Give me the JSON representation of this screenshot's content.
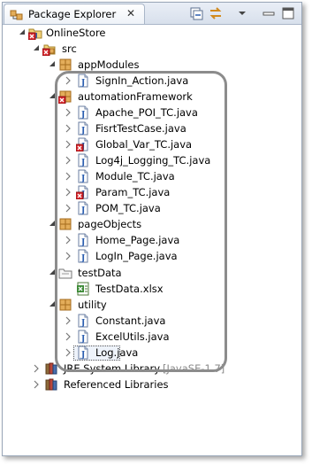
{
  "view": {
    "title": "Package Explorer",
    "close_glyph": "✕"
  },
  "toolbar": {
    "collapse_icon": "collapse-all-icon",
    "link_icon": "link-with-editor-icon"
  },
  "tree": {
    "project": "OnlineStore",
    "src": "src",
    "packages": [
      {
        "name": "appModules",
        "files": [
          "SignIn_Action.java"
        ]
      },
      {
        "name": "automationFramework",
        "files": [
          "Apache_POI_TC.java",
          "FisrtTestCase.java",
          "Global_Var_TC.java",
          "Log4j_Logging_TC.java",
          "Module_TC.java",
          "Param_TC.java",
          "POM_TC.java"
        ]
      },
      {
        "name": "pageObjects",
        "files": [
          "Home_Page.java",
          "LogIn_Page.java"
        ]
      },
      {
        "name": "utility",
        "files": [
          "Constant.java",
          "ExcelUtils.java",
          "Log.java"
        ]
      }
    ],
    "testdata_folder": "testData",
    "testdata_file": "TestData.xlsx",
    "jre_library": "JRE System Library",
    "jre_version": "[JavaSE-1.7]",
    "referenced_libraries": "Referenced Libraries"
  },
  "colors": {
    "error_marker": "#d9262c",
    "package": "#c9892f",
    "java_file": "#2a5db0"
  }
}
